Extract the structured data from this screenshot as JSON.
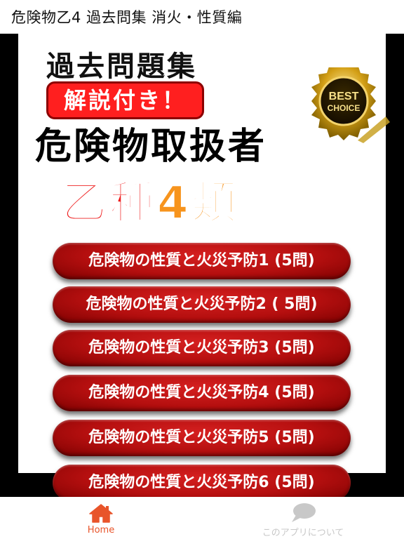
{
  "app": {
    "title": "危険物乙4 過去問集 消火・性質編"
  },
  "banner": {
    "heading": "過去問題集",
    "tagline": "解説付き！",
    "subtitle": "危険物取扱者",
    "otsushu_red": "乙種",
    "otsushu_orange": "4類",
    "badge_line1": "BEST",
    "badge_line2": "CHOICE"
  },
  "buttons": [
    {
      "label": "危険物の性質と火災予防1 (5問)"
    },
    {
      "label": "危険物の性質と火災予防2 ( 5問)"
    },
    {
      "label": "危険物の性質と火災予防3 (5問)"
    },
    {
      "label": "危険物の性質と火災予防4 (5問)"
    },
    {
      "label": "危険物の性質と火災予防5 (5問)"
    },
    {
      "label": "危険物の性質と火災予防6 (5問)"
    }
  ],
  "tabbar": {
    "home_label": "Home",
    "about_label": "このアプリについて",
    "home_icon": "home-icon",
    "about_icon": "chat-bubble-icon",
    "active_color": "#e8542a",
    "inactive_color": "#c8c8c8"
  },
  "colors": {
    "button_red": "#b50f0f",
    "accent_red": "#ee1c1c",
    "accent_orange": "#f7941d",
    "badge_gold": "#d4a017"
  }
}
